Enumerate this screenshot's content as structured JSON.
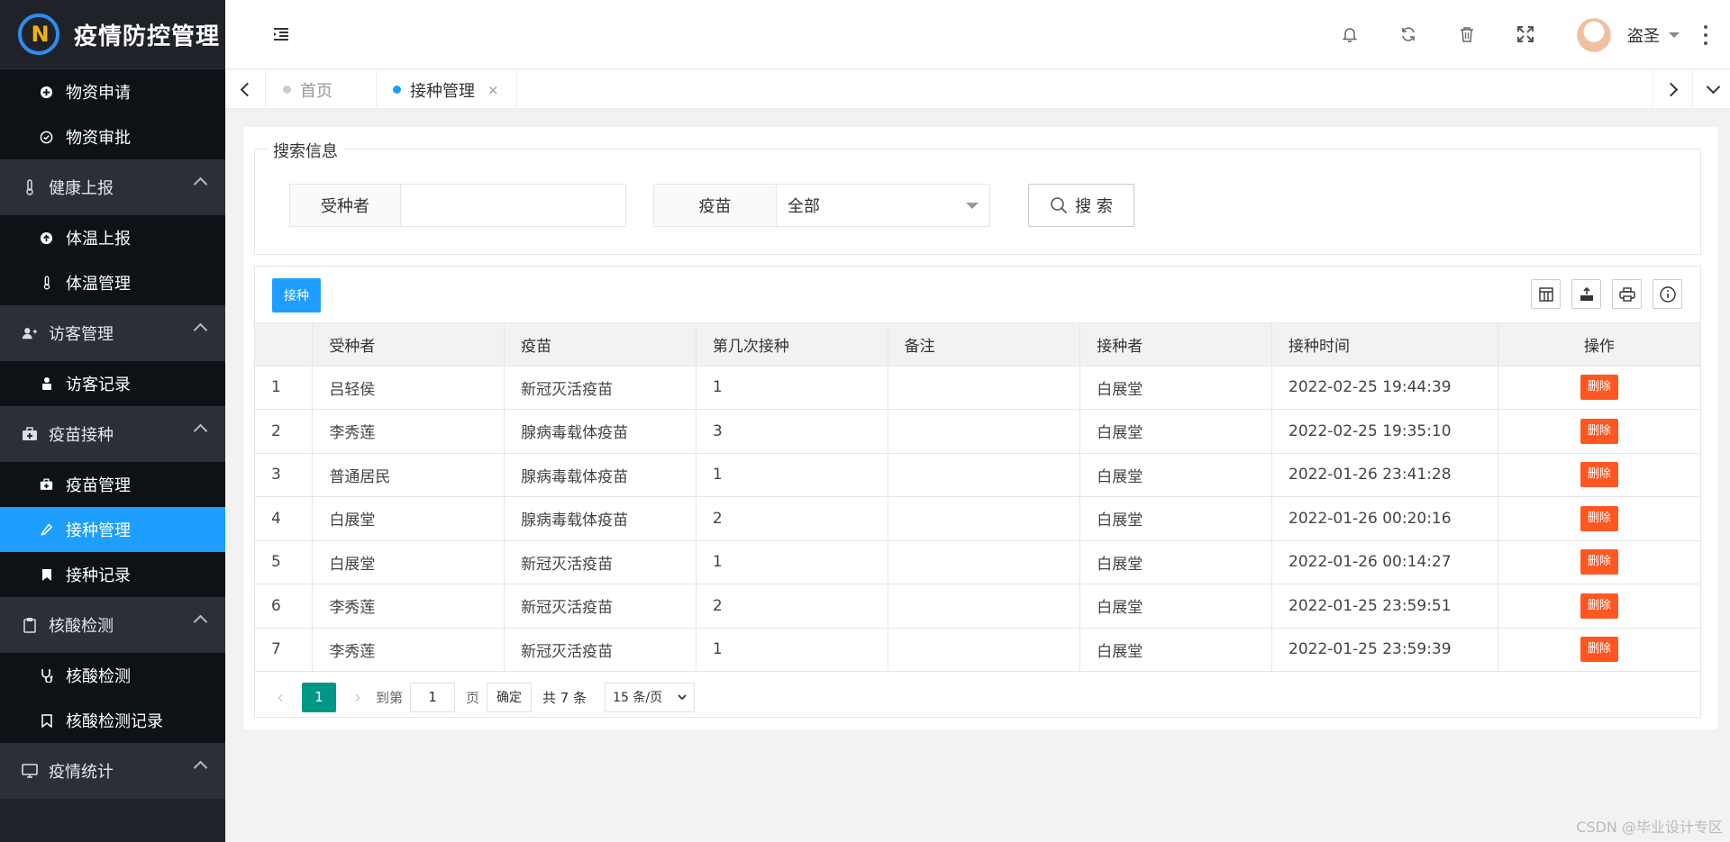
{
  "app": {
    "title": "疫情防控管理"
  },
  "sidebar": {
    "top_items": [
      {
        "label": "物资申请",
        "icon": "plus-circle-icon"
      },
      {
        "label": "物资审批",
        "icon": "check-circle-icon"
      }
    ],
    "groups": [
      {
        "label": "健康上报",
        "icon": "thermometer-icon",
        "items": [
          {
            "label": "体温上报",
            "icon": "upload-circle-icon"
          },
          {
            "label": "体温管理",
            "icon": "thermometer-icon"
          }
        ]
      },
      {
        "label": "访客管理",
        "icon": "users-icon",
        "items": [
          {
            "label": "访客记录",
            "icon": "visitor-icon"
          }
        ]
      },
      {
        "label": "疫苗接种",
        "icon": "medkit-icon",
        "items": [
          {
            "label": "疫苗管理",
            "icon": "medkit-icon"
          },
          {
            "label": "接种管理",
            "icon": "syringe-icon",
            "active": true
          },
          {
            "label": "接种记录",
            "icon": "bookmark-icon"
          }
        ]
      },
      {
        "label": "核酸检测",
        "icon": "clipboard-icon",
        "items": [
          {
            "label": "核酸检测",
            "icon": "stethoscope-icon"
          },
          {
            "label": "核酸检测记录",
            "icon": "bookmark-outline-icon"
          }
        ]
      },
      {
        "label": "疫情统计",
        "icon": "monitor-icon",
        "items": []
      }
    ]
  },
  "header": {
    "username": "盗圣"
  },
  "tabs": [
    {
      "label": "首页",
      "active": false
    },
    {
      "label": "接种管理",
      "active": true,
      "close": "×"
    }
  ],
  "search": {
    "legend": "搜索信息",
    "recipient_label": "受种者",
    "recipient_value": "",
    "vaccine_label": "疫苗",
    "vaccine_selected": "全部",
    "button": "搜 索"
  },
  "toolbar": {
    "add_label": "接种"
  },
  "table": {
    "columns": [
      "",
      "受种者",
      "疫苗",
      "第几次接种",
      "备注",
      "接种者",
      "接种时间",
      "操作"
    ],
    "delete_label": "删除",
    "rows": [
      [
        "1",
        "吕轻侯",
        "新冠灭活疫苗",
        "1",
        "",
        "白展堂",
        "2022-02-25 19:44:39"
      ],
      [
        "2",
        "李秀莲",
        "腺病毒载体疫苗",
        "3",
        "",
        "白展堂",
        "2022-02-25 19:35:10"
      ],
      [
        "3",
        "普通居民",
        "腺病毒载体疫苗",
        "1",
        "",
        "白展堂",
        "2022-01-26 23:41:28"
      ],
      [
        "4",
        "白展堂",
        "腺病毒载体疫苗",
        "2",
        "",
        "白展堂",
        "2022-01-26 00:20:16"
      ],
      [
        "5",
        "白展堂",
        "新冠灭活疫苗",
        "1",
        "",
        "白展堂",
        "2022-01-26 00:14:27"
      ],
      [
        "6",
        "李秀莲",
        "新冠灭活疫苗",
        "2",
        "",
        "白展堂",
        "2022-01-25 23:59:51"
      ],
      [
        "7",
        "李秀莲",
        "新冠灭活疫苗",
        "1",
        "",
        "白展堂",
        "2022-01-25 23:59:39"
      ]
    ]
  },
  "pager": {
    "current": "1",
    "goto_prefix": "到第",
    "goto_value": "1",
    "goto_suffix": "页",
    "confirm": "确定",
    "total": "共 7 条",
    "page_size": "15 条/页"
  },
  "watermark": "CSDN @毕业设计专区",
  "colors": {
    "accent": "#1e9fff",
    "danger": "#ff5722",
    "pager": "#009688",
    "sidebar": "#20222a"
  }
}
